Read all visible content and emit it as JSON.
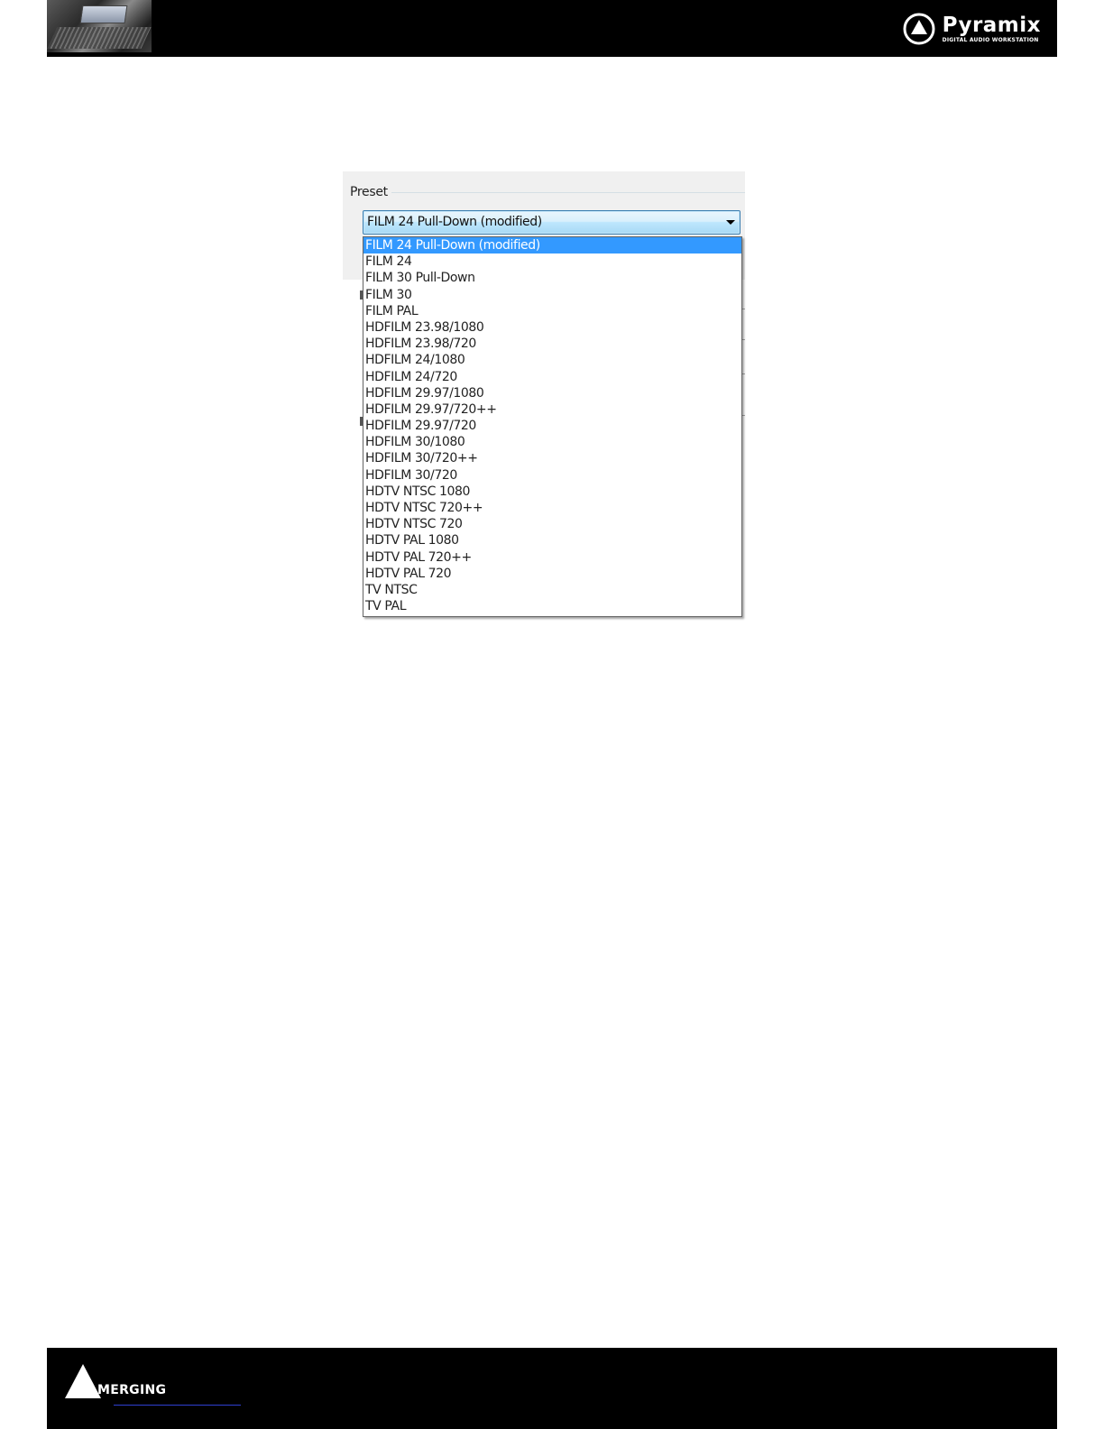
{
  "header": {
    "brand_name": "Pyramix",
    "brand_tagline": "DIGITAL AUDIO WORKSTATION",
    "photo_icon": "console-photo",
    "logo_icon": "pyramix-triangle-logo-icon"
  },
  "preset": {
    "group_label": "Preset",
    "selected_value": "FILM 24 Pull-Down (modified)",
    "options": [
      "FILM 24 Pull-Down (modified)",
      "FILM 24",
      "FILM 30 Pull-Down",
      "FILM 30",
      "FILM PAL",
      "HDFILM 23.98/1080",
      "HDFILM 23.98/720",
      "HDFILM 24/1080",
      "HDFILM 24/720",
      "HDFILM 29.97/1080",
      "HDFILM 29.97/720++",
      "HDFILM 29.97/720",
      "HDFILM 30/1080",
      "HDFILM 30/720++",
      "HDFILM 30/720",
      "HDTV NTSC 1080",
      "HDTV NTSC 720++",
      "HDTV NTSC 720",
      "HDTV PAL 1080",
      "HDTV PAL 720++",
      "HDTV PAL 720",
      "TV NTSC",
      "TV PAL"
    ],
    "highlight_color": "#3399ff"
  },
  "footer": {
    "brand_name": "MERGING",
    "logo_icon": "merging-triangle-logo-icon"
  },
  "colors": {
    "band": "#000000",
    "combo_border": "#3c7fb1",
    "link_underline": "#2f3fd0"
  }
}
